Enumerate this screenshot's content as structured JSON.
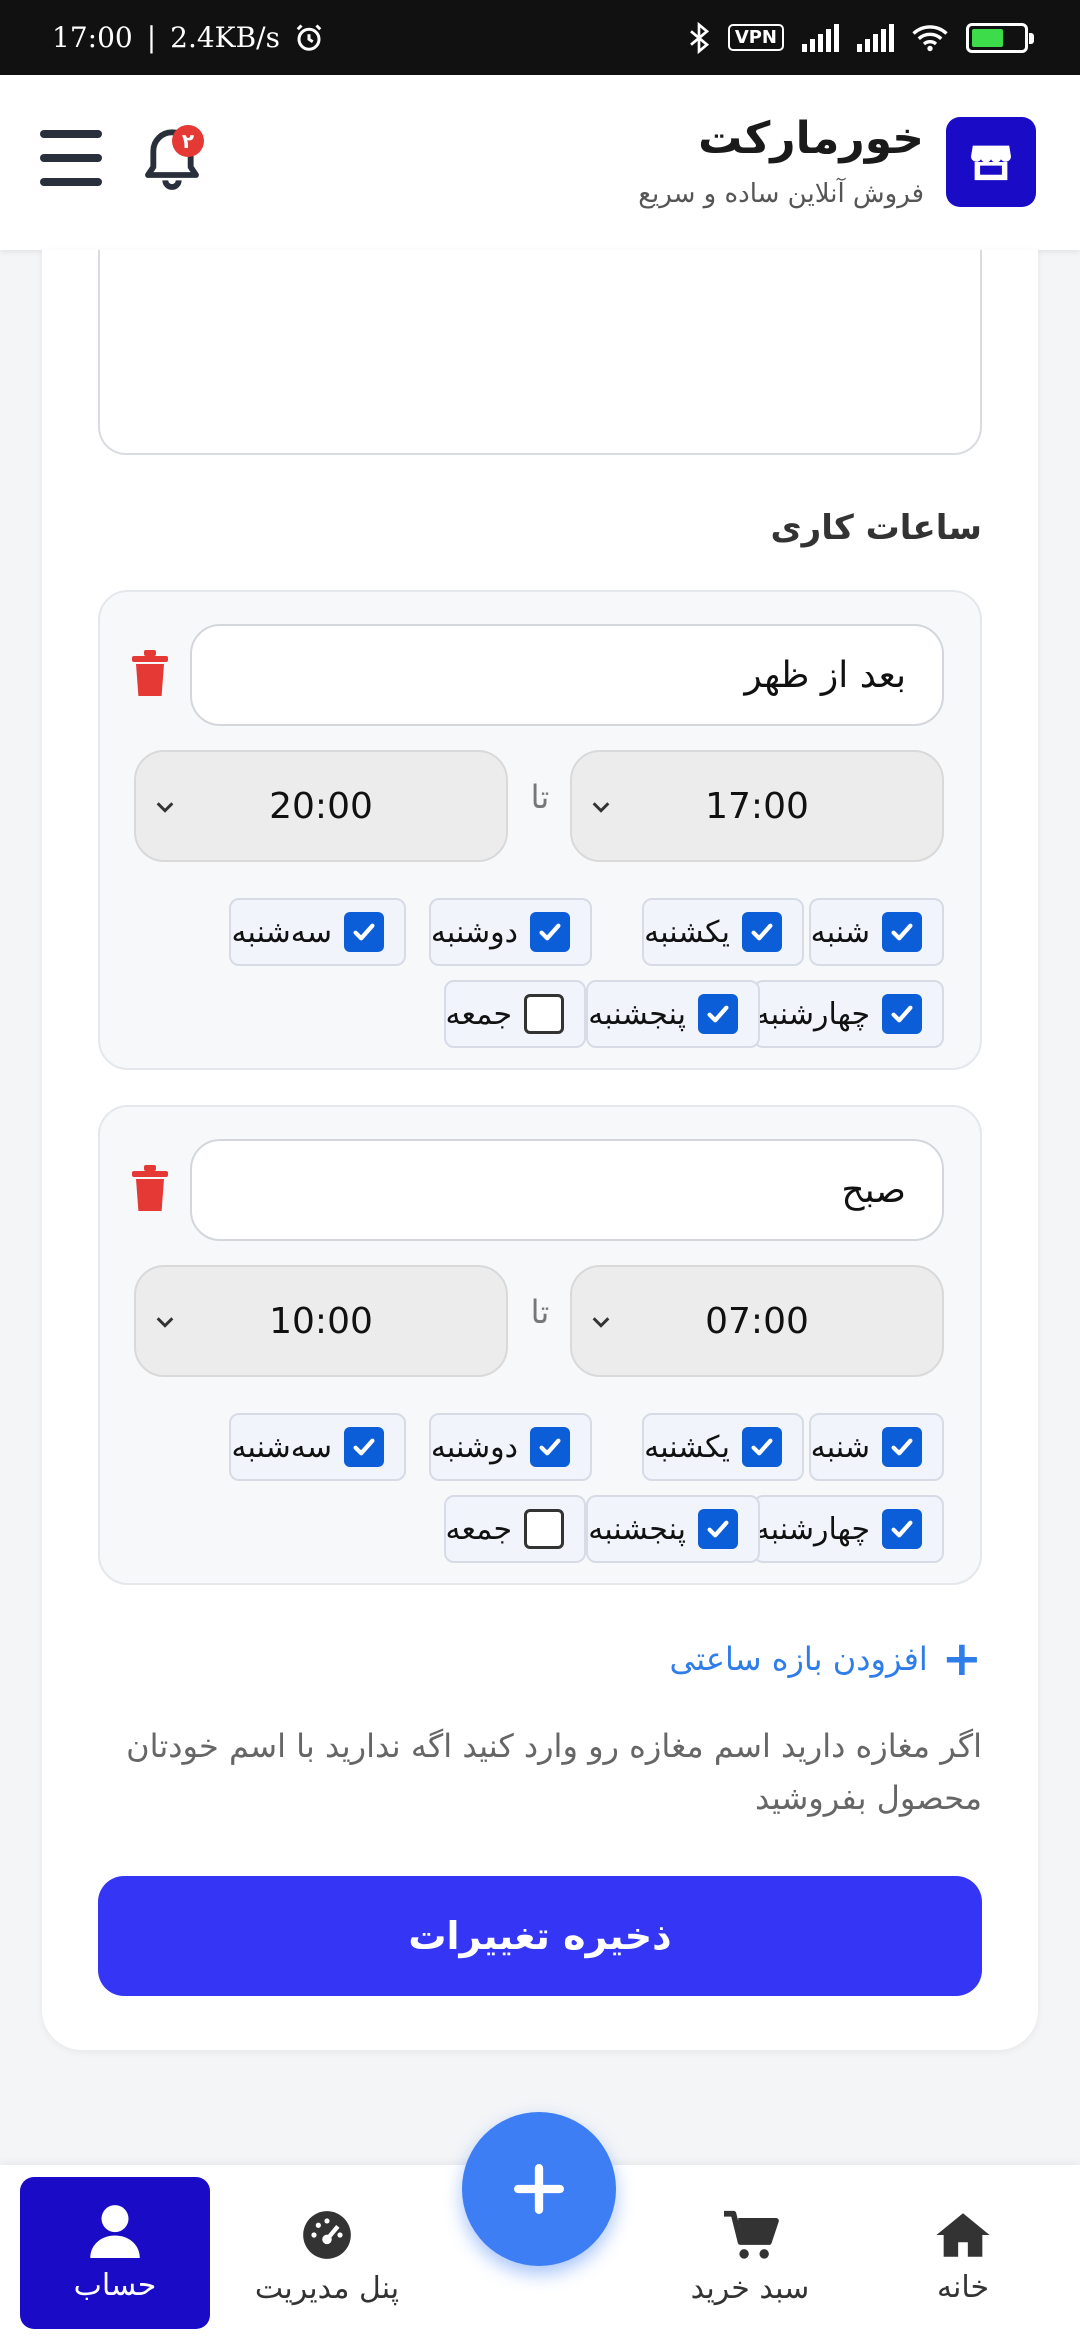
{
  "status_bar": {
    "time": "17:00",
    "separator": "|",
    "speed": "2.4KB/s",
    "vpn_label": "VPN",
    "battery_color": "#3ddc4a"
  },
  "header": {
    "brand_title": "خورمارکت",
    "brand_subtitle": "فروش آنلاین ساده و سریع",
    "notification_count": "۲",
    "logo_color": "#1a0bc7"
  },
  "form": {
    "section_title": "ساعات کاری",
    "to_label": "تا",
    "slots": [
      {
        "name": "بعد از ظهر",
        "from": "17:00",
        "to": "20:00",
        "days": [
          {
            "label": "شنبه",
            "checked": true
          },
          {
            "label": "یکشنبه",
            "checked": true
          },
          {
            "label": "دوشنبه",
            "checked": true
          },
          {
            "label": "سه‌شنبه",
            "checked": true
          },
          {
            "label": "چهارشنبه",
            "checked": true
          },
          {
            "label": "پنجشنبه",
            "checked": true
          },
          {
            "label": "جمعه",
            "checked": false
          }
        ]
      },
      {
        "name": "صبح",
        "from": "07:00",
        "to": "10:00",
        "days": [
          {
            "label": "شنبه",
            "checked": true
          },
          {
            "label": "یکشنبه",
            "checked": true
          },
          {
            "label": "دوشنبه",
            "checked": true
          },
          {
            "label": "سه‌شنبه",
            "checked": true
          },
          {
            "label": "چهارشنبه",
            "checked": true
          },
          {
            "label": "پنجشنبه",
            "checked": true
          },
          {
            "label": "جمعه",
            "checked": false
          }
        ]
      }
    ],
    "add_slot_label": "افزودن بازه ساعتی",
    "note": "اگر مغازه دارید اسم مغازه رو وارد کنید اگه ندارید با اسم خودتان محصول بفروشید",
    "save_label": "ذخیره تغییرات",
    "save_color": "#3535f5"
  },
  "bottom_nav": {
    "items": [
      {
        "label": "خانه",
        "icon": "home-icon"
      },
      {
        "label": "سبد خرید",
        "icon": "cart-icon"
      },
      {
        "label": "پنل مدیریت",
        "icon": "dashboard-icon"
      },
      {
        "label": "حساب",
        "icon": "user-icon",
        "active": true
      }
    ],
    "fab_icon": "plus-icon"
  }
}
